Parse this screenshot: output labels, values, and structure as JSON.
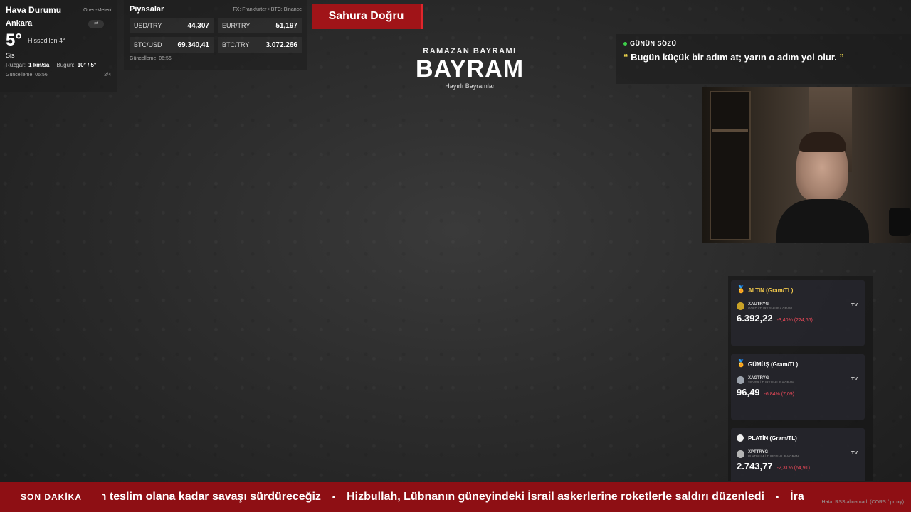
{
  "weather": {
    "title": "Hava Durumu",
    "source": "Open-Meteo",
    "city": "Ankara",
    "toggle_label": "⇄",
    "temp": "5°",
    "feels_like": "Hissedilen 4°",
    "condition": "Sis",
    "wind_label": "Rüzgar:",
    "wind_value": "1 km/sa",
    "today_label": "Bugün:",
    "today_value": "10° / 5°",
    "updated": "Güncelleme: 06:56",
    "page": "2/4"
  },
  "markets": {
    "title": "Piyasalar",
    "source": "FX: Frankfurter • BTC: Binance",
    "items": [
      {
        "name": "USD/TRY",
        "value": "44,307"
      },
      {
        "name": "EUR/TRY",
        "value": "51,197"
      },
      {
        "name": "BTC/USD",
        "value": "69.340,41"
      },
      {
        "name": "BTC/TRY",
        "value": "3.072.266"
      }
    ],
    "updated": "Güncelleme: 06:56"
  },
  "sahur": {
    "label": "Sahura Doğru"
  },
  "holiday": {
    "subtitle": "RAMAZAN BAYRAMI",
    "title": "BAYRAM",
    "wish": "Hayırlı Bayramlar"
  },
  "quote": {
    "heading": "GÜNÜN SÖZÜ",
    "open_mark": "“",
    "text": "Bugün küçük bir adım at; yarın o adım yol olur.",
    "close_mark": "”"
  },
  "metals": [
    {
      "title": "ALTIN (Gram/TL)",
      "icon": "medal-gold-icon",
      "symbol": "XAUTRYG",
      "description": "GOLD / TURKISH LIRA GRAM",
      "price": "6.392,22",
      "change": "-3,40% (224,66)",
      "tv": "TV",
      "coin_color": "#c9a227",
      "icon_color": "#e6b422"
    },
    {
      "title": "GÜMÜŞ (Gram/TL)",
      "icon": "medal-silver-icon",
      "symbol": "XAGTRYG",
      "description": "SILVER / TURKISH LIRA GRAM",
      "price": "96,49",
      "change": "-6,84% (7,09)",
      "tv": "TV",
      "coin_color": "#9ca3ad",
      "icon_color": "#7fb3d5"
    },
    {
      "title": "PLATİN (Gram/TL)",
      "icon": "platinum-dot-icon",
      "symbol": "XPTTRYG",
      "description": "PLATINUM / TURKISH LIRA GRAM",
      "price": "2.743,77",
      "change": "-2,31% (64,91)",
      "tv": "TV",
      "coin_color": "#b5b5b5",
      "icon_color": "#f0f0f0"
    }
  ],
  "api_error": "Hata: RSS alınamadı (CORS / proxy).",
  "ticker": {
    "label": "SON DAKİKA",
    "items": [
      "nen teslim olana kadar savaşı sürdüreceğiz",
      "Hizbullah, Lübnanın güneyindeki İsrail askerlerine roketlerle saldırı düzenledi",
      "İra"
    ],
    "separator": "•"
  }
}
